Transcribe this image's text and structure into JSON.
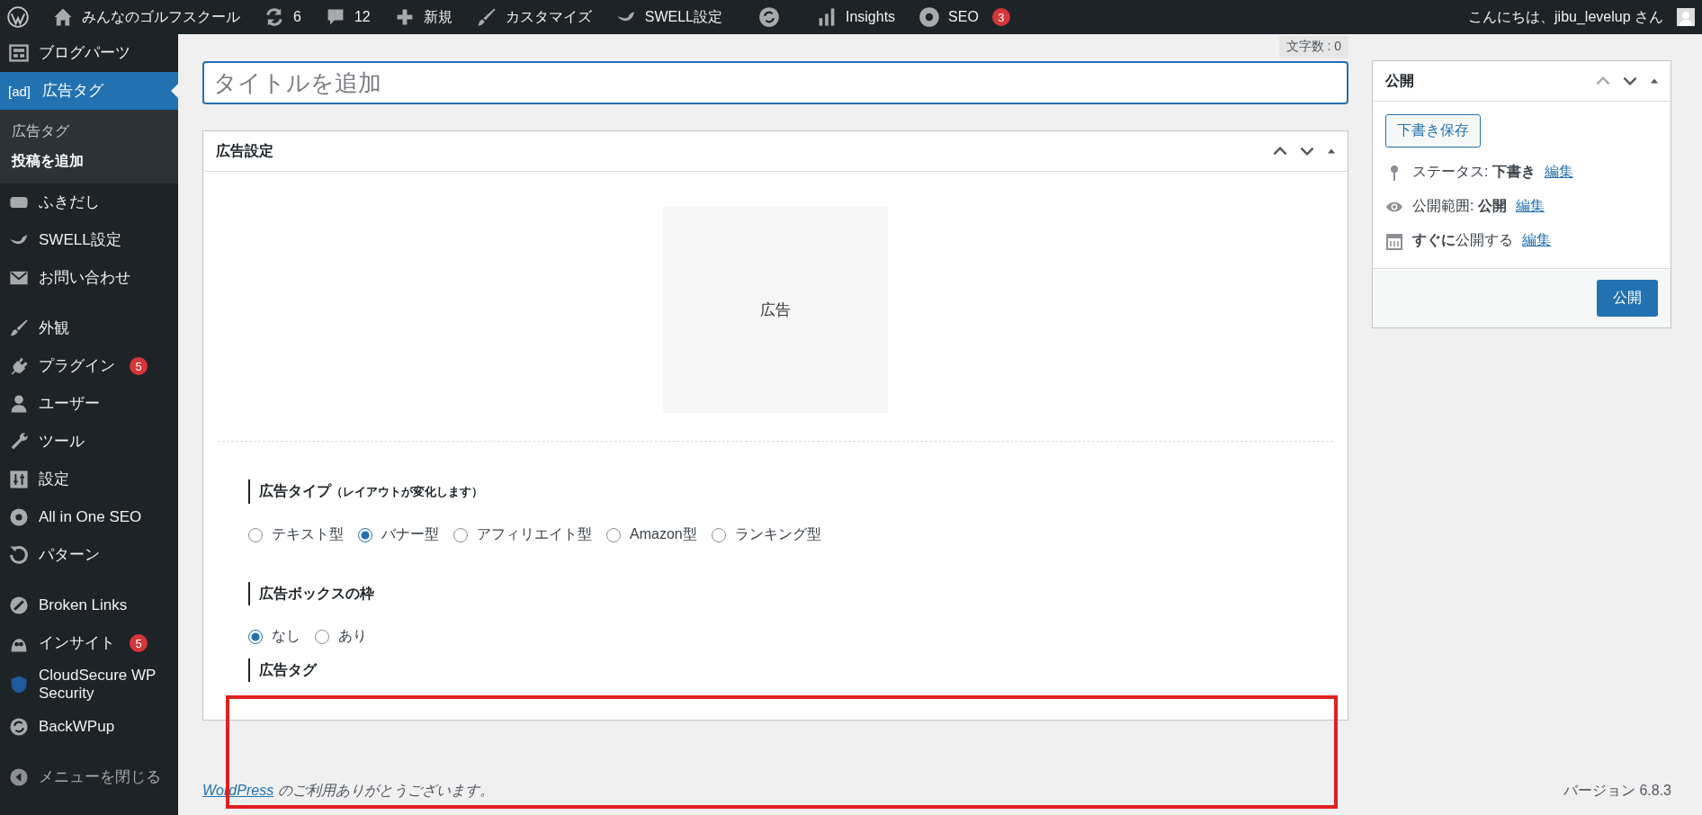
{
  "admin_bar": {
    "site_name": "みんなのゴルフスクール",
    "updates": "6",
    "comments": "12",
    "new": "新規",
    "customize": "カスタマイズ",
    "swell": "SWELL設定",
    "insights": "Insights",
    "seo": "SEO",
    "seo_badge": "3",
    "greeting": "こんにちは、jibu_levelup さん"
  },
  "sidebar": {
    "groups": [
      {
        "items": [
          {
            "label": "ブログパーツ",
            "selected": false
          },
          {
            "label": "広告タグ",
            "glyph": "[ad]",
            "selected": true,
            "children": [
              {
                "label": "広告タグ",
                "selected": false
              },
              {
                "label": "投稿を追加",
                "selected": true
              }
            ]
          },
          {
            "label": "ふきだし",
            "selected": false
          },
          {
            "label": "SWELL設定",
            "selected": false
          },
          {
            "label": "お問い合わせ",
            "selected": false
          }
        ]
      },
      {
        "items": [
          {
            "label": "外観",
            "selected": false
          },
          {
            "label": "プラグイン",
            "badge": "5",
            "selected": false
          },
          {
            "label": "ユーザー",
            "selected": false
          },
          {
            "label": "ツール",
            "selected": false
          },
          {
            "label": "設定",
            "selected": false
          },
          {
            "label": "All in One SEO",
            "selected": false
          },
          {
            "label": "パターン",
            "selected": false
          }
        ]
      },
      {
        "items": [
          {
            "label": "Broken Links",
            "selected": false
          },
          {
            "label": "インサイト",
            "badge": "5",
            "selected": false
          },
          {
            "label": "CloudSecure WP Security",
            "selected": false
          },
          {
            "label": "BackWPup",
            "selected": false
          }
        ]
      }
    ],
    "collapse": "メニューを閉じる"
  },
  "editor": {
    "word_count": "文字数 : 0",
    "title": {
      "placeholder": "タイトルを追加"
    }
  },
  "ad_settings": {
    "title": "広告設定",
    "preview": "広告",
    "sections": [
      {
        "heading": "広告タイプ",
        "note": "（レイアウトが変化します）",
        "options": [
          {
            "label": "テキスト型",
            "selected": false
          },
          {
            "label": "バナー型",
            "selected": true
          },
          {
            "label": "アフィリエイト型",
            "selected": false
          },
          {
            "label": "Amazon型",
            "selected": false
          },
          {
            "label": "ランキング型",
            "selected": false
          }
        ]
      },
      {
        "heading": "広告ボックスの枠",
        "options": [
          {
            "label": "なし",
            "selected": true
          },
          {
            "label": "あり",
            "selected": false
          }
        ]
      },
      {
        "heading": "広告タグ"
      }
    ]
  },
  "publish": {
    "title": "公開",
    "save_draft": "下書き保存",
    "rows": [
      {
        "text": "ステータス: **下書き**",
        "link": "編集"
      },
      {
        "text": "公開範囲: **公開**",
        "link": "編集"
      },
      {
        "text": "**すぐに**公開する",
        "link": "編集"
      }
    ],
    "button": "公開"
  },
  "footer": {
    "link": "WordPress",
    "thanks": "のご利用ありがとうございます。",
    "version": "バージョン 6.8.3"
  },
  "highlight_frame": true
}
